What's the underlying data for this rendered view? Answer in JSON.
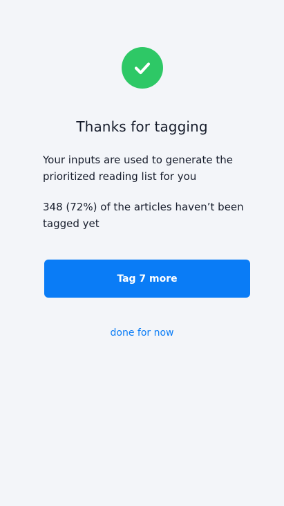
{
  "success_icon": {
    "icon": "check-icon",
    "color": "#2ec866"
  },
  "title": "Thanks for tagging",
  "info": {
    "line1": "Your inputs are used to generate the prioritized reading list for you",
    "line2": "348 (72%) of the articles haven’t been tagged yet"
  },
  "actions": {
    "primary_label": "Tag 7 more",
    "primary_color": "#0a7cf6",
    "secondary_label": "done for now"
  }
}
